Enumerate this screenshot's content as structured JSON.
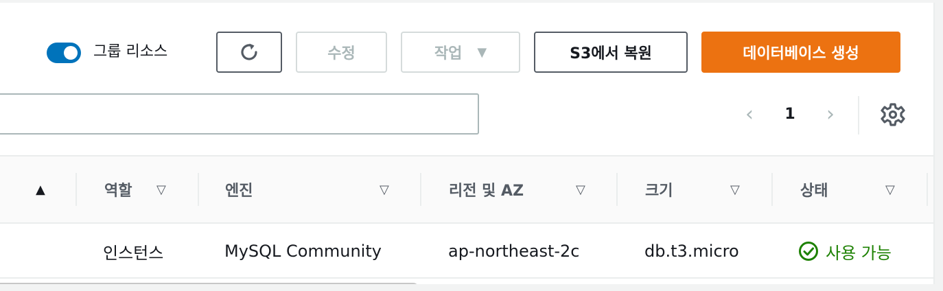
{
  "toolbar": {
    "group_resources_label": "그룹 리소스",
    "group_resources_on": true,
    "refresh_icon": "refresh-icon",
    "edit_label": "수정",
    "actions_label": "작업",
    "restore_s3_label": "S3에서 복원",
    "create_db_label": "데이터베이스 생성"
  },
  "search": {
    "value": ""
  },
  "pagination": {
    "current_page": "1"
  },
  "table": {
    "columns": [
      "역할",
      "엔진",
      "리전 및 AZ",
      "크기",
      "상태"
    ],
    "sorted_column_icon": "sort-ascending-icon",
    "rows": [
      {
        "role": "인스턴스",
        "engine": "MySQL Community",
        "region_az": "ap-northeast-2c",
        "size": "db.t3.micro",
        "status": "사용 가능"
      }
    ]
  },
  "colors": {
    "primary": "#ec7211",
    "toggle_on": "#0073bb",
    "status_available": "#1d8102"
  }
}
